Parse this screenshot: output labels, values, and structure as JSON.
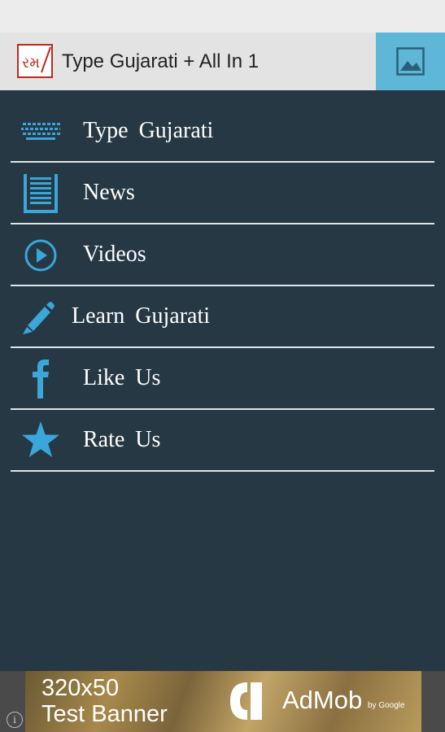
{
  "app": {
    "title": "Type Gujarati + All In 1",
    "logo_glyph": "રમ",
    "action_icon": "image-icon"
  },
  "menu": {
    "items": [
      {
        "label": "Type Gujarati",
        "icon": "keyboard-icon"
      },
      {
        "label": "News",
        "icon": "document-icon"
      },
      {
        "label": "Videos",
        "icon": "play-circle-icon"
      },
      {
        "label": "Learn Gujarati",
        "icon": "pencil-icon"
      },
      {
        "label": "Like Us",
        "icon": "facebook-icon"
      },
      {
        "label": "Rate Us",
        "icon": "star-icon"
      }
    ]
  },
  "ad": {
    "line1": "320x50",
    "line2": "Test Banner",
    "brand": "AdMob",
    "brand_suffix": "by Google",
    "info_glyph": "i"
  },
  "colors": {
    "background": "#263843",
    "accent": "#3aa6da",
    "action_button": "#5fb7d8",
    "divider": "#dfe4e7"
  }
}
